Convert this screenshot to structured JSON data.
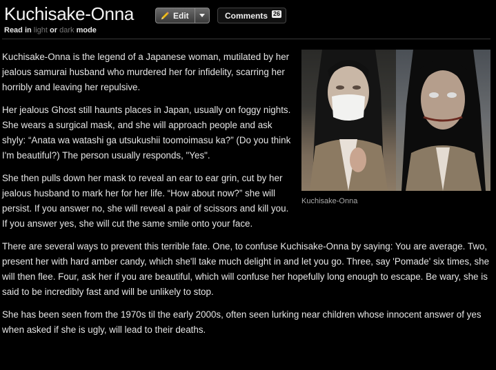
{
  "article": {
    "title": "Kuchisake-Onna",
    "edit_label": "Edit",
    "comments_label": "Comments",
    "comments_count": "26",
    "read_mode": {
      "prefix": "Read in ",
      "light": "light",
      "or": " or ",
      "dark": "dark",
      "suffix": " mode"
    }
  },
  "figure": {
    "caption": "Kuchisake-Onna"
  },
  "paragraphs": [
    "Kuchisake-Onna is the legend of a Japanese woman, mutilated by her jealous samurai husband who murdered her for infidelity, scarring her horribly and leaving her repulsive.",
    "Her jealous Ghost still haunts places in Japan, usually on foggy nights. She wears a surgical mask, and she will approach people and ask shyly: “Anata wa watashi ga utsukushii toomoimasu ka?” (Do you think I'm beautiful?) The person usually responds, \"Yes\".",
    "She then pulls down her mask to reveal an ear to ear grin, cut by her jealous husband to mark her for her life. “How about now?” she will persist. If you answer no, she will reveal a pair of scissors and kill you. If you answer yes, she will cut the same smile onto your face.",
    "There are several ways to prevent this terrible fate. One, to confuse Kuchisake-Onna by saying: You are average. Two, present her with hard amber candy, which she'll take much delight in and let you go. Three, say 'Pomade' six times, she will then flee. Four, ask her if you are beautiful, which will confuse her hopefully long enough to escape. Be wary, she is said to be incredibly fast and will be unlikely to stop.",
    "She has been seen from the 1970s til the early 2000s, often seen lurking near children whose innocent answer of yes when asked if she is ugly, will lead to their deaths."
  ]
}
